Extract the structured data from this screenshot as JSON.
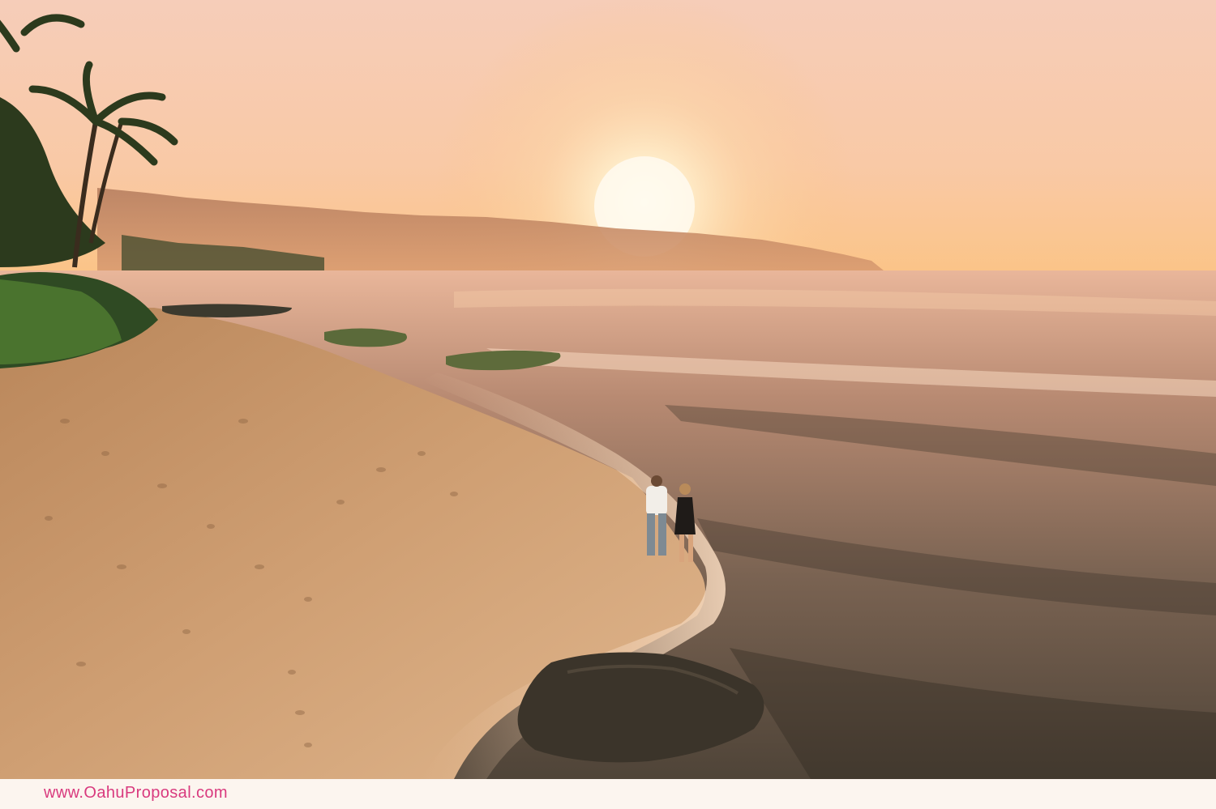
{
  "watermark": {
    "text": "www.OahuProposal.com",
    "color": "#d93a7e"
  },
  "scene": {
    "palette": {
      "sky_top": "#f6cdb9",
      "sky_horizon": "#fbc487",
      "sun": "#fffbe8",
      "mountain": "#c98a62",
      "sea_far": "#e3a98a",
      "sea_near": "#4f4438",
      "sand": "#cf9f73",
      "rock": "#3b342a",
      "foliage": "#2f4a23"
    }
  }
}
